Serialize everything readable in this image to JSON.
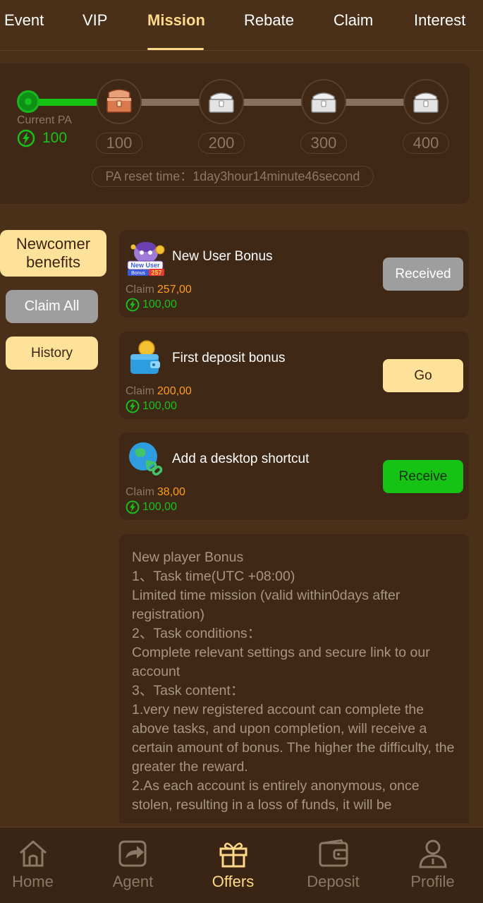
{
  "tabs": [
    {
      "label": "Event"
    },
    {
      "label": "VIP"
    },
    {
      "label": "Mission"
    },
    {
      "label": "Rebate"
    },
    {
      "label": "Claim"
    },
    {
      "label": "Interest"
    }
  ],
  "active_tab": "Mission",
  "pa": {
    "current_label": "Current PA",
    "current_value": "100",
    "progress_fraction": 0.18,
    "milestones": [
      "100",
      "200",
      "300",
      "400"
    ],
    "reset_text": "PA reset time：1day3hour14minute46second"
  },
  "sidebar": {
    "newcomer_label": "Newcomer benefits",
    "claim_all_label": "Claim All",
    "history_label": "History"
  },
  "missions": [
    {
      "title": "New User Bonus",
      "claim_label": "Claim",
      "claim_amount": "257,00",
      "points": "100,00",
      "button": "Received",
      "icon": "new-user-bonus-badge-icon"
    },
    {
      "title": "First deposit bonus",
      "claim_label": "Claim",
      "claim_amount": "200,00",
      "points": "100,00",
      "button": "Go",
      "icon": "wallet-coin-icon"
    },
    {
      "title": "Add a desktop shortcut",
      "claim_label": "Claim",
      "claim_amount": "38,00",
      "points": "100,00",
      "button": "Receive",
      "icon": "globe-link-icon"
    }
  ],
  "rules": [
    "New player Bonus",
    "1、Task time(UTC +08:00)",
    "Limited time mission (valid within0days after registration)",
    "2、Task conditions：",
    "Complete relevant settings and secure link to our account",
    "3、Task content：",
    "1.very new registered account can complete the above tasks, and upon completion, will receive a certain amount of bonus. The higher the difficulty, the greater the reward.",
    "2.As each account is entirely anonymous, once stolen, resulting in a loss of funds, it will be"
  ],
  "bottom_nav": [
    {
      "label": "Home",
      "icon": "home-icon"
    },
    {
      "label": "Agent",
      "icon": "share-icon"
    },
    {
      "label": "Offers",
      "icon": "gift-icon"
    },
    {
      "label": "Deposit",
      "icon": "wallet-icon"
    },
    {
      "label": "Profile",
      "icon": "user-icon"
    }
  ],
  "colors": {
    "background": "#4a3019",
    "card": "#3f2815",
    "accent": "#ffd98a",
    "green": "#16c31d",
    "orange": "#ff9d1e",
    "muted": "#8c7866"
  }
}
